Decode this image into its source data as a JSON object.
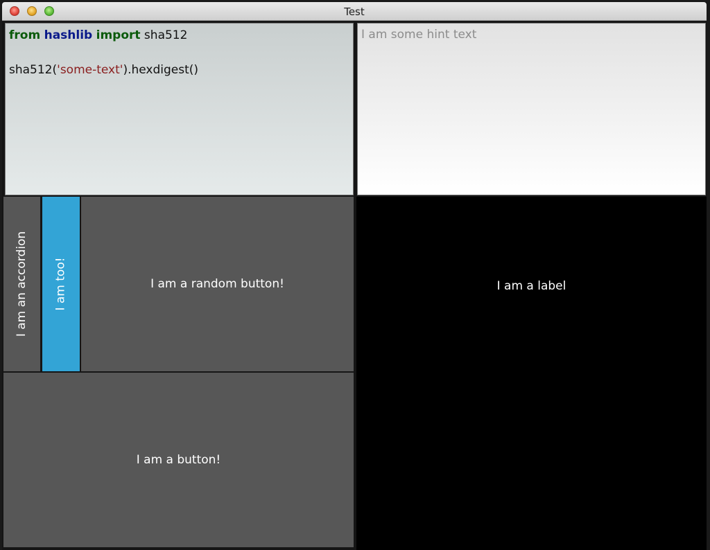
{
  "window": {
    "title": "Test"
  },
  "code_editor": {
    "lines": [
      {
        "kw1": "from",
        "mod": "hashlib",
        "kw2": "import",
        "rest": " sha512"
      },
      {
        "text": ""
      },
      {
        "pre": "sha512(",
        "str": "'some-text'",
        "post": ").hexdigest()"
      }
    ]
  },
  "text_input": {
    "hint": "I am some hint text"
  },
  "accordion": {
    "items": [
      {
        "label": "I am an accordion"
      },
      {
        "label": "I am too!"
      }
    ]
  },
  "random_button": {
    "label": "I am a random button!"
  },
  "main_button": {
    "label": "I am a button!"
  },
  "label_panel": {
    "text": "I am a label"
  },
  "colors": {
    "accordion_active": "#33a4d6",
    "button": "#575757",
    "label_bg": "#000000"
  }
}
